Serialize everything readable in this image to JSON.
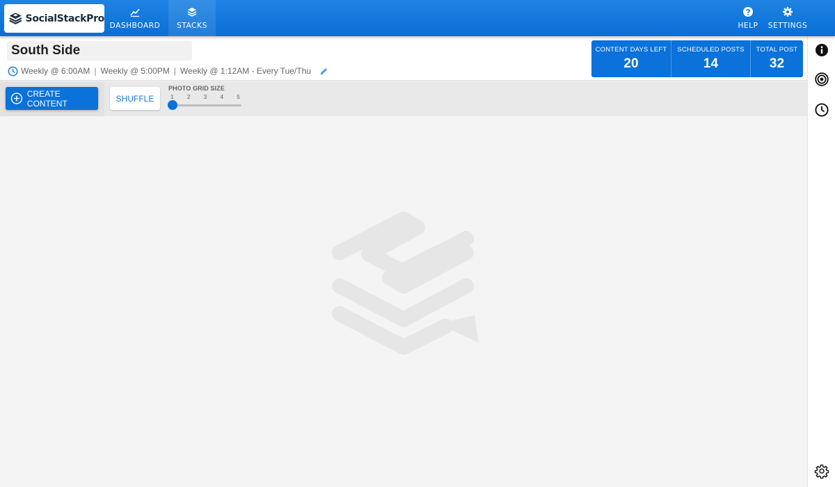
{
  "app": {
    "logo_text": "SocialStackPro"
  },
  "nav": {
    "dashboard_label": "DASHBOARD",
    "stacks_label": "STACKS",
    "help_label": "HELP",
    "settings_label": "SETTINGS"
  },
  "stack": {
    "title": "South Side",
    "schedules": [
      "Weekly @ 6:00AM",
      "Weekly @ 5:00PM",
      "Weekly @ 1:12AM - Every Tue/Thu"
    ],
    "separator": "|"
  },
  "stats": {
    "content_days_left": {
      "label": "CONTENT DAYS LEFT",
      "value": "20"
    },
    "scheduled_posts": {
      "label": "SCHEDULED POSTS",
      "value": "14"
    },
    "total_post": {
      "label": "TOTAL POST",
      "value": "32"
    }
  },
  "toolbar": {
    "create_label": "CREATE CONTENT",
    "shuffle_label": "SHUFFLE",
    "grid_size_label": "PHOTO GRID SIZE",
    "grid_size_options": [
      "1",
      "2",
      "3",
      "4",
      "5"
    ],
    "grid_size_value": 1
  },
  "icons": {
    "dashboard": "chart-line-icon",
    "stacks": "layers-icon",
    "help": "question-circle-icon",
    "settings": "gear-icon",
    "schedule": "clock-icon",
    "edit": "pencil-icon",
    "create": "plus-circle-icon",
    "rail": [
      "info-icon",
      "target-icon",
      "clock-icon",
      "gear-icon"
    ]
  },
  "colors": {
    "primary": "#0a72da",
    "accent_link": "#1a78d8",
    "background": "#f4f4f4"
  }
}
